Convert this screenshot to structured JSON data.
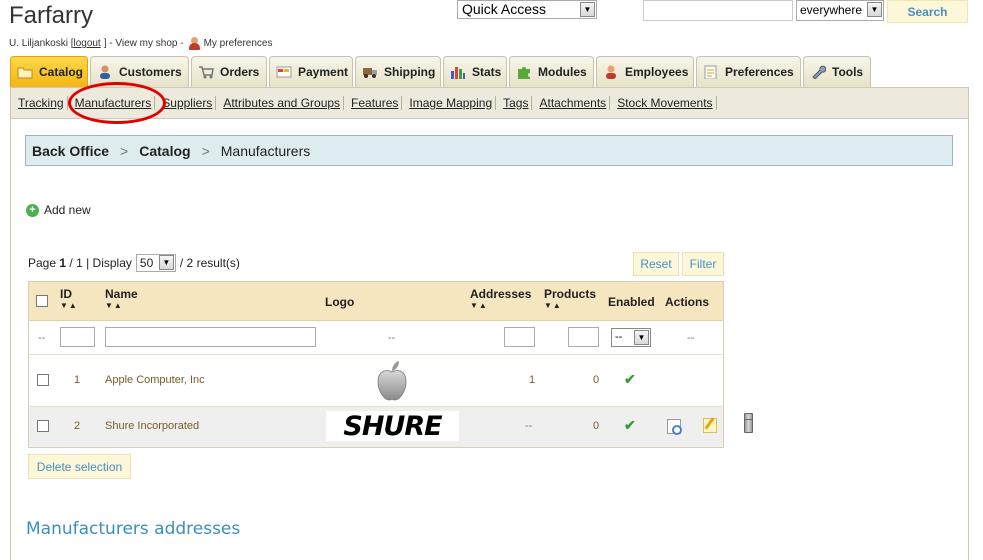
{
  "header": {
    "shop_name": "Farfarry",
    "user_prefix": "U. Liljankoski [",
    "logout": "logout",
    "user_mid": "] - View my shop -",
    "preferences": "My preferences",
    "quick_access": "Quick Access",
    "search_placeholder": "",
    "search_scope": "everywhere",
    "search_button": "Search"
  },
  "tabs": [
    {
      "label": "Catalog",
      "icon": "folder-icon",
      "active": true
    },
    {
      "label": "Customers",
      "icon": "customer-icon"
    },
    {
      "label": "Orders",
      "icon": "cart-icon"
    },
    {
      "label": "Payment",
      "icon": "payment-icon"
    },
    {
      "label": "Shipping",
      "icon": "truck-icon"
    },
    {
      "label": "Stats",
      "icon": "chart-icon"
    },
    {
      "label": "Modules",
      "icon": "puzzle-icon"
    },
    {
      "label": "Employees",
      "icon": "employee-icon"
    },
    {
      "label": "Preferences",
      "icon": "preferences-icon"
    },
    {
      "label": "Tools",
      "icon": "wrench-icon"
    }
  ],
  "subnav": [
    "Tracking",
    "Manufacturers",
    "Suppliers",
    "Attributes and Groups",
    "Features",
    "Image Mapping",
    "Tags",
    "Attachments",
    "Stock Movements"
  ],
  "breadcrumb": {
    "root": "Back Office",
    "section": "Catalog",
    "current": "Manufacturers",
    "separator": ">"
  },
  "add_new": "Add new",
  "pager": {
    "page_label": "Page",
    "page": "1",
    "total_pages": "/ 1",
    "display_label": "| Display",
    "per_page": "50",
    "results": "/ 2 result(s)"
  },
  "buttons": {
    "reset": "Reset",
    "filter": "Filter",
    "delete_selection": "Delete selection"
  },
  "table": {
    "columns": {
      "id": "ID",
      "name": "Name",
      "logo": "Logo",
      "addresses": "Addresses",
      "products": "Products",
      "enabled": "Enabled",
      "actions": "Actions"
    },
    "sort_arrows": "▼▲",
    "filter_row": {
      "dash": "--",
      "logo": "--",
      "enabled_select": "--",
      "actions": "--"
    },
    "rows": [
      {
        "id": "1",
        "name": "Apple Computer, Inc",
        "logo": "apple-logo",
        "addresses": "1",
        "products": "0",
        "enabled": "✔"
      },
      {
        "id": "2",
        "name": "Shure Incorporated",
        "logo": "SHURE",
        "addresses": "--",
        "products": "0",
        "enabled": "✔"
      }
    ]
  },
  "section_title": "Manufacturers addresses",
  "colors": {
    "accent": "#3a8fbd",
    "active_tab": "#f5b515",
    "highlight_circle": "#e00000"
  }
}
